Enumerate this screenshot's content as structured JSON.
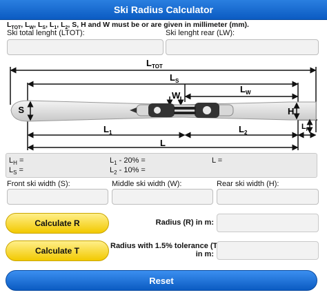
{
  "app": {
    "title": "Ski Radius Calculator"
  },
  "note": "LTOT, LW, LS, L1, L2, S, H and W must be or are given in millimeter (mm).",
  "fields": {
    "total_length_label": "Ski total lenght (LTOT):",
    "rear_length_label": "Ski lenght rear (LW):",
    "front_width_label": "Front ski width (S):",
    "middle_width_label": "Middle ski width (W):",
    "rear_width_label": "Rear ski width (H):"
  },
  "diagram": {
    "L_TOT": "LTOT",
    "L_S": "LS",
    "L_W": "LW",
    "W": "W",
    "S": "S",
    "H": "H",
    "L_1": "L1",
    "L_2": "L2",
    "L": "L",
    "L_H": "LH"
  },
  "results": {
    "lh": "LH =",
    "ls": "LS =",
    "l1_20": "L1 - 20% =",
    "l2_10": "L2 - 10% =",
    "l": "L ="
  },
  "actions": {
    "calc_r": "Calculate R",
    "calc_t": "Calculate T",
    "radius_label": "Radius (R) in m:",
    "radius_tol_label_1": "Radius with 1.5% tolerance (T)",
    "radius_tol_label_2": "in m:",
    "reset": "Reset"
  },
  "colors": {
    "header_blue": "#0b5bc2",
    "button_yellow": "#f2c900"
  }
}
